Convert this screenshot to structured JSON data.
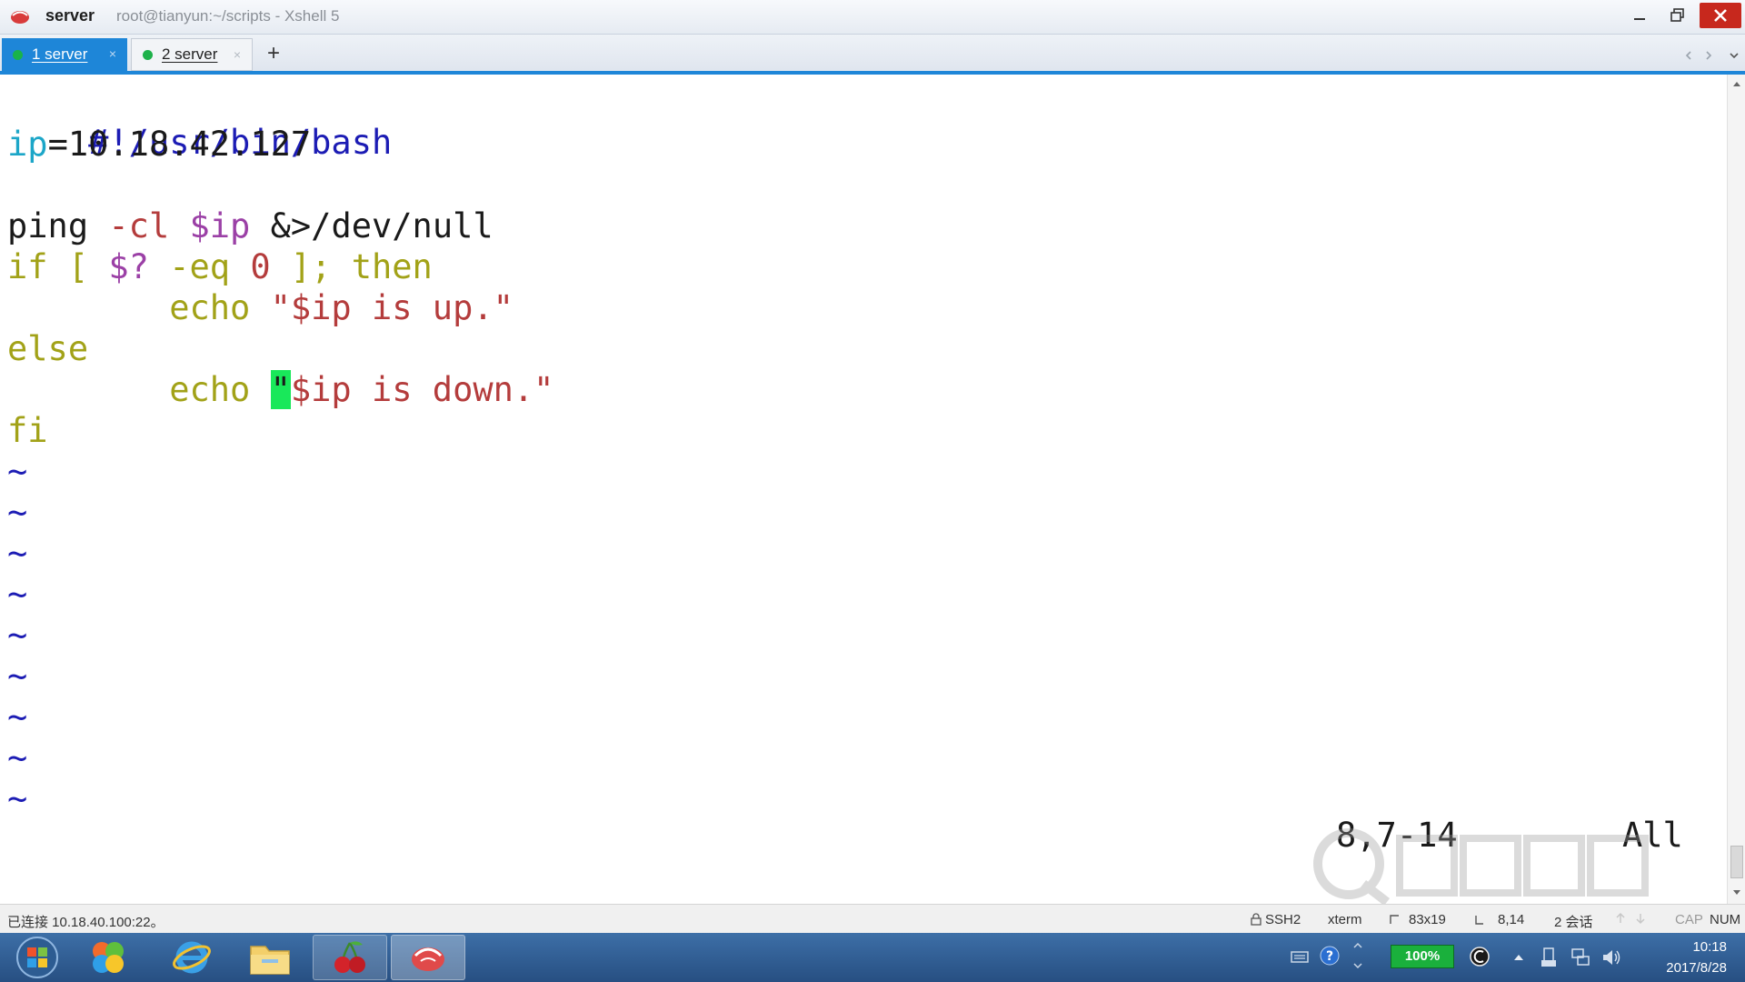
{
  "window": {
    "title_bold": "server",
    "title_rest": "root@tianyun:~/scripts - Xshell 5"
  },
  "tabs": [
    {
      "label": "1 server",
      "active": true
    },
    {
      "label": "2 server",
      "active": false
    }
  ],
  "tab_close": "×",
  "tab_add": "+",
  "editor": {
    "l1": "#!/usr/bin/bash",
    "l2_var": "ip",
    "l2_rest": "=10.18.42.127",
    "l4_a": "ping ",
    "l4_b": "-cl",
    "l4_c": " $ip ",
    "l4_d": "&>",
    "l4_e": "/dev/null",
    "l5_a": "if [ ",
    "l5_b": "$?",
    "l5_c": " -eq ",
    "l5_d": "0",
    "l5_e": " ]; then",
    "l6_a": "        echo ",
    "l6_b": "\"$ip is up.\"",
    "l7": "else",
    "l8_a": "        echo ",
    "l8_cursor": "\"",
    "l8_b": "$ip is down.\"",
    "l9": "fi",
    "tilde": "~",
    "ruler_pos": "8,7-14",
    "ruler_all": "All"
  },
  "status": {
    "connection": "已连接 10.18.40.100:22。",
    "protocol": "SSH2",
    "terminal": "xterm",
    "size": "83x19",
    "cursor": "8,14",
    "sessions": "2 会话",
    "cap": "CAP",
    "num": "NUM"
  },
  "taskbar": {
    "battery": "100%",
    "time": "10:18",
    "date": "2017/8/28"
  },
  "colors": {
    "accent": "#1e86d8",
    "close": "#c7281d",
    "cursor": "#19e85a"
  }
}
